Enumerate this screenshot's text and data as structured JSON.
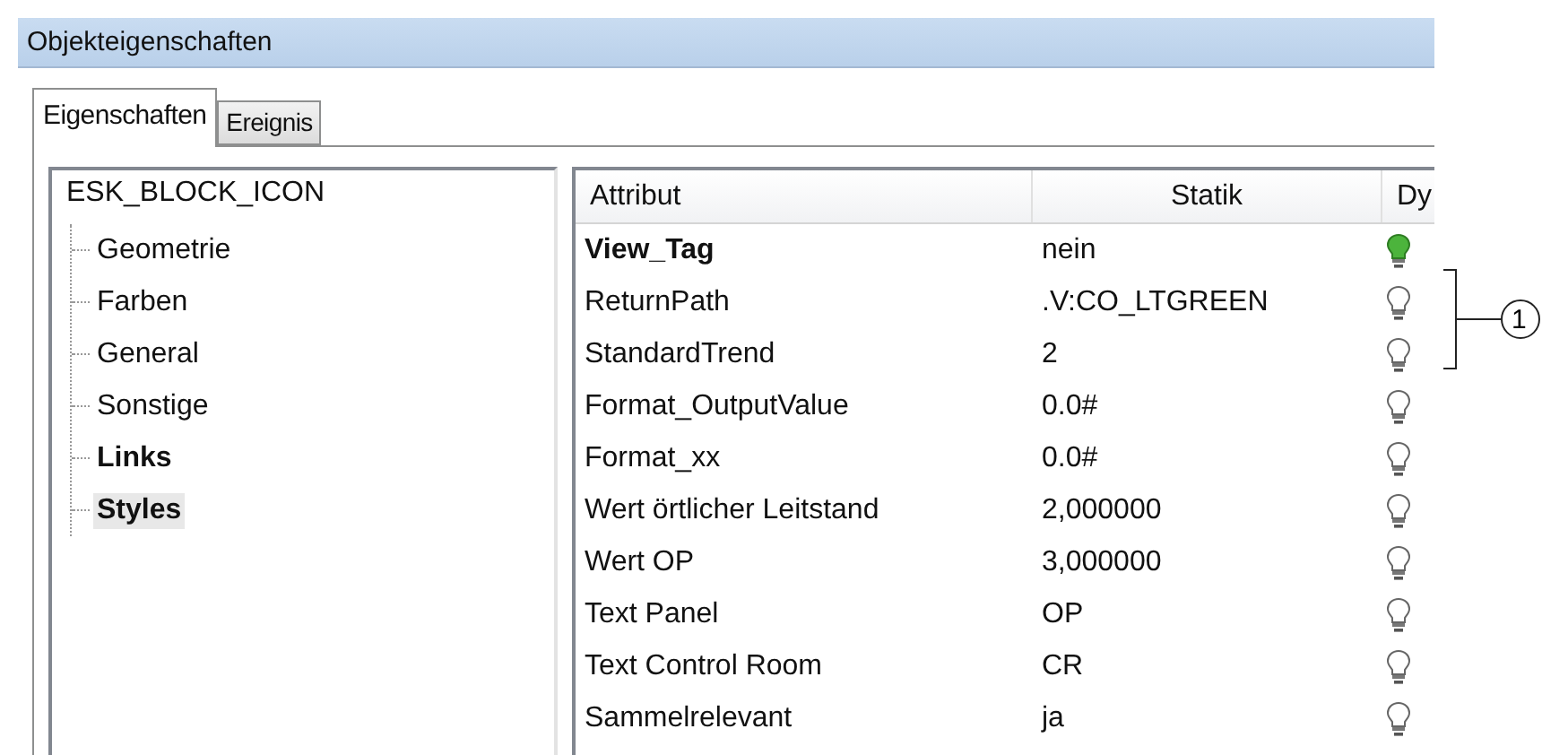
{
  "window": {
    "title": "Objekteigenschaften"
  },
  "tabs": [
    {
      "label": "Eigenschaften",
      "selected": true
    },
    {
      "label": "Ereignis",
      "selected": false
    }
  ],
  "tree": {
    "label": "ESK_BLOCK_ICON",
    "children": [
      {
        "label": "Geometrie",
        "bold": false,
        "selected": false
      },
      {
        "label": "Farben",
        "bold": false,
        "selected": false
      },
      {
        "label": "General",
        "bold": false,
        "selected": false
      },
      {
        "label": "Sonstige",
        "bold": false,
        "selected": false
      },
      {
        "label": "Links",
        "bold": true,
        "selected": false
      },
      {
        "label": "Styles",
        "bold": true,
        "selected": true
      }
    ]
  },
  "table": {
    "columns": [
      "Attribut",
      "Statik",
      "Dy"
    ],
    "rows": [
      {
        "attribute": "View_Tag",
        "value": "nein",
        "bold": true,
        "lit": true
      },
      {
        "attribute": "ReturnPath",
        "value": ".V:CO_LTGREEN",
        "bold": false,
        "lit": false
      },
      {
        "attribute": "StandardTrend",
        "value": "2",
        "bold": false,
        "lit": false
      },
      {
        "attribute": "Format_OutputValue",
        "value": "0.0#",
        "bold": false,
        "lit": false
      },
      {
        "attribute": "Format_xx",
        "value": "0.0#",
        "bold": false,
        "lit": false
      },
      {
        "attribute": "Wert örtlicher Leitstand",
        "value": "2,000000",
        "bold": false,
        "lit": false
      },
      {
        "attribute": "Wert OP",
        "value": "3,000000",
        "bold": false,
        "lit": false
      },
      {
        "attribute": "Text Panel",
        "value": "OP",
        "bold": false,
        "lit": false
      },
      {
        "attribute": "Text Control Room",
        "value": "CR",
        "bold": false,
        "lit": false
      },
      {
        "attribute": "Sammelrelevant",
        "value": "ja",
        "bold": false,
        "lit": false
      }
    ]
  },
  "callout": {
    "label": "1"
  }
}
